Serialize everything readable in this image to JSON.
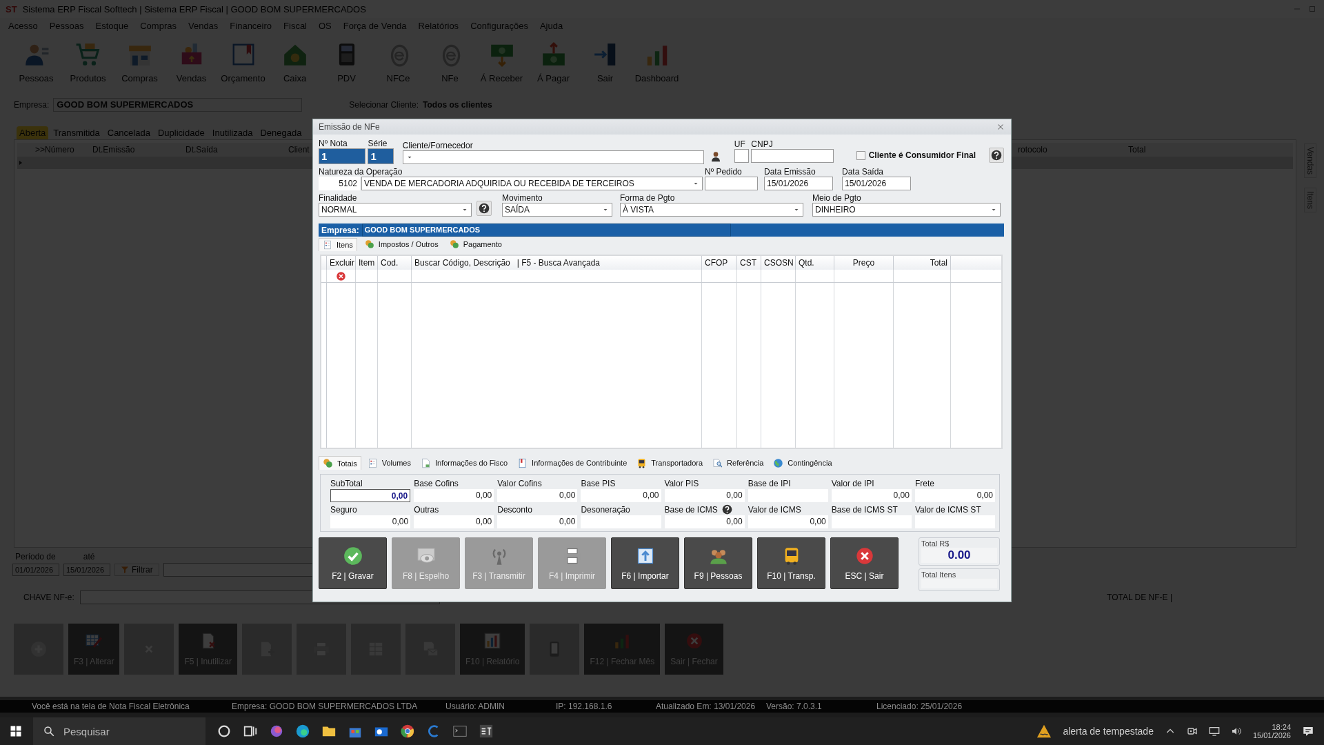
{
  "window": {
    "logo": "ST",
    "title": "Sistema ERP Fiscal Softtech | Sistema ERP Fiscal | GOOD BOM SUPERMERCADOS"
  },
  "menu": [
    "Acesso",
    "Pessoas",
    "Estoque",
    "Compras",
    "Vendas",
    "Financeiro",
    "Fiscal",
    "OS",
    "Força de Venda",
    "Relatórios",
    "Configurações",
    "Ajuda"
  ],
  "toolbar": [
    "Pessoas",
    "Produtos",
    "Compras",
    "Vendas",
    "Orçamento",
    "Caixa",
    "PDV",
    "NFCe",
    "NFe",
    "Á Receber",
    "Á Pagar",
    "Sair",
    "Dashboard"
  ],
  "filter": {
    "company_label": "Empresa:",
    "company": "GOOD BOM SUPERMERCADOS",
    "client_label": "Selecionar Cliente:",
    "client": "Todos os clientes"
  },
  "status_tabs": [
    {
      "label": "Aberta",
      "selected": true
    },
    {
      "label": "Transmitida",
      "selected": false
    },
    {
      "label": "Cancelada",
      "selected": false
    },
    {
      "label": "Duplicidade",
      "selected": false
    },
    {
      "label": "Inutilizada",
      "selected": false
    },
    {
      "label": "Denegada",
      "selected": false
    }
  ],
  "notes_grid": {
    "columns": [
      ">>Número",
      "Dt.Emissão",
      "Dt.Saída",
      "Client",
      "rotocolo",
      "Total"
    ]
  },
  "side_tabs": [
    "Vendas",
    "Itens"
  ],
  "period": {
    "from_label": "Período de",
    "to_label": "até",
    "from": "01/01/2026",
    "to": "15/01/2026",
    "filter_button": "Filtrar"
  },
  "key_field": {
    "label": "CHAVE NF-e:"
  },
  "total_label": "TOTAL DE NF-E |",
  "actions": [
    {
      "enabled": false
    },
    {
      "label": "F3 | Alterar",
      "enabled": true
    },
    {
      "enabled": false
    },
    {
      "label": "F5 | Inutilizar",
      "enabled": true
    },
    {
      "enabled": false
    },
    {
      "enabled": false
    },
    {
      "enabled": false
    },
    {
      "enabled": false
    },
    {
      "label": "F10 | Relatório",
      "enabled": true
    },
    {
      "enabled": false
    },
    {
      "label": "F12 | Fechar Mês",
      "enabled": true
    },
    {
      "label": "Sair | Fechar",
      "enabled": true
    }
  ],
  "status_bar": [
    "Você está na tela de Nota Fiscal Eletrônica",
    "Empresa: GOOD BOM SUPERMERCADOS LTDA",
    "Usuário: ADMIN",
    "IP: 192.168.1.6",
    "Atualizado Em: 13/01/2026",
    "Versão: 7.0.3.1",
    "Licenciado: 25/01/2026"
  ],
  "taskbar": {
    "search_placeholder": "Pesquisar",
    "weather": "alerta de tempestade",
    "time": "18:24",
    "date": "15/01/2026"
  },
  "dialog": {
    "title": "Emissão de NFe",
    "number": {
      "label": "Nº Nota",
      "value": "1"
    },
    "series": {
      "label": "Série",
      "value": "1"
    },
    "client": {
      "label": "Cliente/Fornecedor"
    },
    "uf": {
      "label": "UF"
    },
    "cnpj": {
      "label": "CNPJ"
    },
    "final_consumer": {
      "label": "Cliente é Consumidor Final",
      "checked": false
    },
    "operation": {
      "label": "Natureza da Operação",
      "code": "5102",
      "value": "VENDA DE MERCADORIA ADQUIRIDA OU RECEBIDA DE TERCEIROS"
    },
    "order_number": {
      "label": "Nº Pedido"
    },
    "issue_date": {
      "label": "Data Emissão",
      "value": "15/01/2026"
    },
    "exit_date": {
      "label": "Data Saída",
      "value": "15/01/2026"
    },
    "purpose": {
      "label": "Finalidade",
      "value": "NORMAL"
    },
    "movement": {
      "label": "Movimento",
      "value": "SAÍDA"
    },
    "payment_form": {
      "label": "Forma de Pgto",
      "value": "À VISTA"
    },
    "payment_means": {
      "label": "Meio de Pgto",
      "value": "DINHEIRO"
    },
    "company_bar": {
      "label": "Empresa:",
      "value": "GOOD BOM SUPERMERCADOS"
    },
    "tabs": [
      {
        "label": "Itens",
        "selected": true
      },
      {
        "label": "Impostos / Outros",
        "selected": false
      },
      {
        "label": "Pagamento",
        "selected": false
      }
    ],
    "items_grid": {
      "columns": [
        "Excluir",
        "Item",
        "Cod.",
        "Buscar Código, Descrição   | F5 - Busca Avançada",
        "CFOP",
        "CST",
        "CSOSN",
        "Qtd.",
        "Preço",
        "Total"
      ],
      "rows": [
        {
          "deletable": true
        }
      ]
    },
    "totals_tabs": [
      {
        "label": "Totais",
        "selected": true
      },
      {
        "label": "Volumes",
        "selected": false
      },
      {
        "label": "Informações do Fisco",
        "selected": false
      },
      {
        "label": "Informações de Contribuinte",
        "selected": false
      },
      {
        "label": "Transportadora",
        "selected": false
      },
      {
        "label": "Referência",
        "selected": false
      },
      {
        "label": "Contingência",
        "selected": false
      }
    ],
    "totals": [
      {
        "label": "SubTotal",
        "amount": "0,00",
        "focused": true,
        "help": false
      },
      {
        "label": "Base Cofins",
        "amount": "0,00",
        "focused": false,
        "help": false
      },
      {
        "label": "Valor Cofins",
        "amount": "0,00",
        "focused": false,
        "help": false
      },
      {
        "label": "Base PIS",
        "amount": "0,00",
        "focused": false,
        "help": false
      },
      {
        "label": "Valor PIS",
        "amount": "0,00",
        "focused": false,
        "help": false
      },
      {
        "label": "Base de IPI",
        "focused": false,
        "help": false
      },
      {
        "label": "Valor de IPI",
        "amount": "0,00",
        "focused": false,
        "help": false
      },
      {
        "label": "Frete",
        "amount": "0,00",
        "focused": false,
        "help": false
      },
      {
        "label": "Seguro",
        "amount": "0,00",
        "focused": false,
        "help": false
      },
      {
        "label": "Outras",
        "amount": "0,00",
        "focused": false,
        "help": false
      },
      {
        "label": "Desconto",
        "amount": "0,00",
        "focused": false,
        "help": false
      },
      {
        "label": "Desoneração",
        "focused": false,
        "help": false
      },
      {
        "label": "Base de ICMS",
        "amount": "0,00",
        "focused": false,
        "help": true
      },
      {
        "label": "Valor de ICMS",
        "amount": "0,00",
        "focused": false,
        "help": false
      },
      {
        "label": "Base de ICMS ST",
        "focused": false,
        "help": false
      },
      {
        "label": "Valor de ICMS ST",
        "focused": false,
        "help": false
      }
    ],
    "buttons": [
      {
        "label": "F2 | Gravar",
        "enabled": true
      },
      {
        "label": "F8 | Espelho",
        "enabled": false
      },
      {
        "label": "F3 | Transmitir",
        "enabled": false
      },
      {
        "label": "F4 | Imprimir",
        "enabled": false
      },
      {
        "label": "F6 | Importar",
        "enabled": true
      },
      {
        "label": "F9 | Pessoas",
        "enabled": true
      },
      {
        "label": "F10 | Transp.",
        "enabled": true
      },
      {
        "label": "ESC | Sair",
        "enabled": true
      }
    ],
    "total_amount": {
      "label": "Total R$",
      "value": "0.00"
    },
    "total_items": {
      "label": "Total Itens"
    }
  }
}
